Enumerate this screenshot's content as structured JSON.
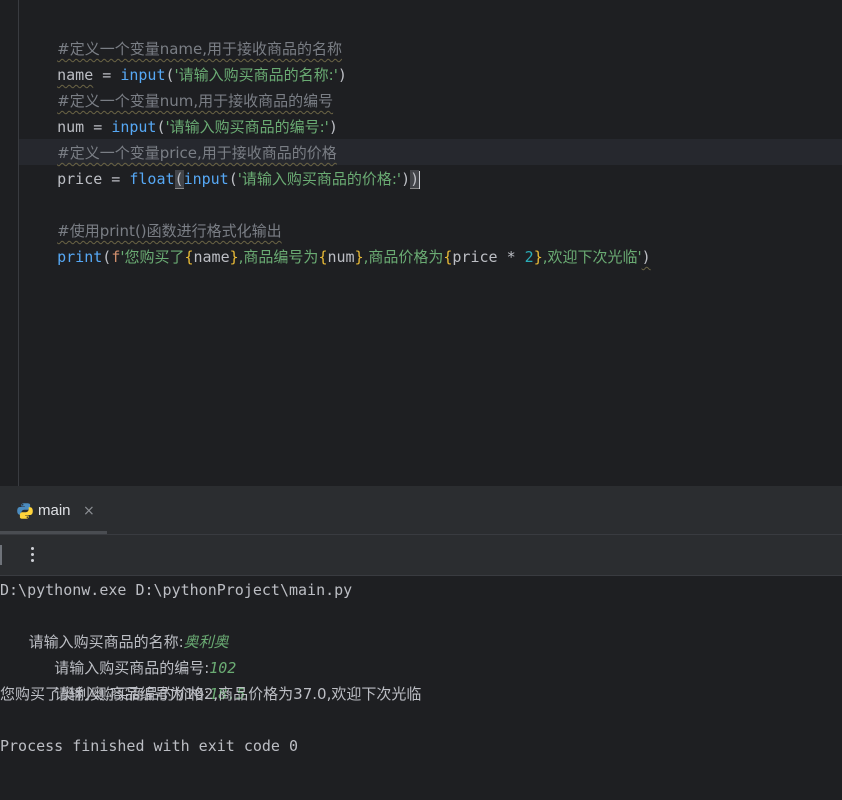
{
  "editor": {
    "lines": [
      {
        "id": "l1",
        "comment": "#定义一个变量name,用于接收商品的名称"
      },
      {
        "id": "l2",
        "var": "name",
        "eq": " = ",
        "fn": "input",
        "open": "(",
        "str": "'请输入购买商品的名称:'",
        "close": ")"
      },
      {
        "id": "l3",
        "comment": "#定义一个变量num,用于接收商品的编号"
      },
      {
        "id": "l4",
        "var": "num",
        "eq": " = ",
        "fn": "input",
        "open": "(",
        "str": "'请输入购买商品的编号:'",
        "close": ")"
      },
      {
        "id": "l5",
        "comment": "#定义一个变量price,用于接收商品的价格"
      },
      {
        "id": "l6",
        "var": "price",
        "eq": " = ",
        "fn1": "float",
        "open1": "(",
        "fn2": "input",
        "open2": "(",
        "str": "'请输入购买商品的价格:'",
        "close2": ")",
        "close1": ")"
      },
      {
        "id": "l8",
        "comment": "#使用print()函数进行格式化输出"
      },
      {
        "id": "l9",
        "fn": "print",
        "open": "(",
        "prefix": "f",
        "s1": "'您购买了",
        "b1o": "{",
        "v1": "name",
        "b1c": "}",
        "s2": ",商品编号为",
        "b2o": "{",
        "v2": "num",
        "b2c": "}",
        "s3": ",商品价格为",
        "b3o": "{",
        "v3": "price * ",
        "n3": "2",
        "b3c": "}",
        "s4": ",欢迎下次光临'",
        "close": ")"
      }
    ]
  },
  "run_panel": {
    "tab_label": "main",
    "tab_close": "×",
    "icons": {
      "tab": "python-icon",
      "close": "close-icon",
      "more": "more-vertical-icon"
    },
    "console": {
      "cmd": "D:\\pythonw.exe D:\\pythonProject\\main.py",
      "prompt1": "请输入购买商品的名称:",
      "input1": "奥利奥",
      "prompt2": "请输入购买商品的编号:",
      "input2": "102",
      "prompt3": "请输入购买商品的价格:",
      "input3": "18.5",
      "result": "您购买了奥利奥,商品编号为102,商品价格为37.0,欢迎下次光临",
      "exit": "Process finished with exit code 0"
    }
  },
  "colors": {
    "background": "#1e1f22",
    "panel": "#2b2d30",
    "comment": "#7a7e85",
    "function": "#56a8f5",
    "string": "#6aab73",
    "number": "#2aacb8",
    "fstring_prefix": "#cf8e6d",
    "brace": "#e8ba36"
  }
}
